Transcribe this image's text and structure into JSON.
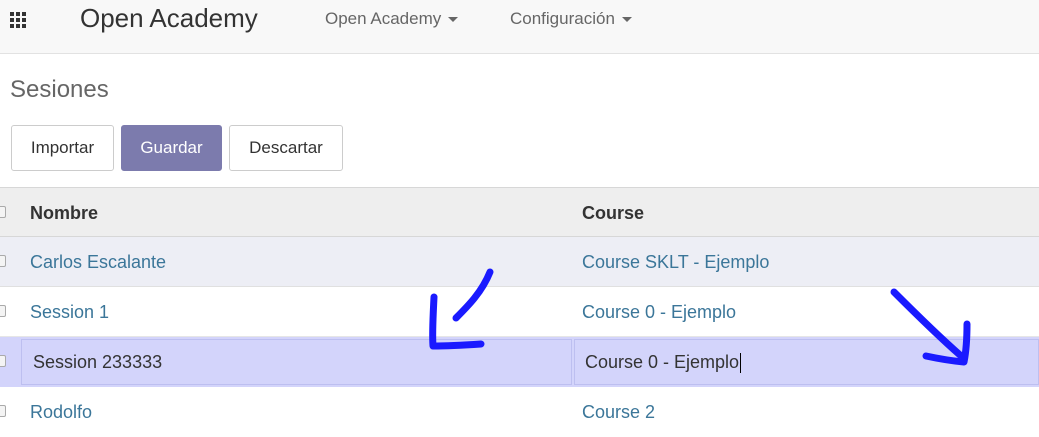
{
  "navbar": {
    "app_title": "Open Academy",
    "menus": [
      {
        "label": "Open Academy"
      },
      {
        "label": "Configuración"
      }
    ]
  },
  "control_panel": {
    "title": "Sesiones",
    "import_label": "Importar",
    "save_label": "Guardar",
    "discard_label": "Descartar"
  },
  "table": {
    "columns": [
      "Nombre",
      "Course"
    ],
    "rows": [
      {
        "name": "Carlos Escalante",
        "course": "Course SKLT - Ejemplo"
      },
      {
        "name": "Session 1",
        "course": "Course 0 - Ejemplo"
      },
      {
        "name": "Session 233333",
        "course": "Course 0 - Ejemplo"
      },
      {
        "name": "Rodolfo",
        "course": "Course 2"
      }
    ]
  },
  "colors": {
    "primary": "#7c7bad",
    "link": "#3b7699",
    "editing_row": "#d3d4fb",
    "annotation": "#1a1aff"
  }
}
